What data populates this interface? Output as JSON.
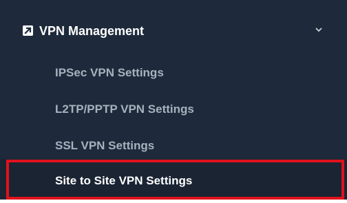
{
  "menu": {
    "header": {
      "label": "VPN Management",
      "icon": "external-link-icon",
      "chevron_icon": "chevron-down-icon",
      "expanded": true
    },
    "items": [
      {
        "label": "IPSec VPN Settings",
        "active": false
      },
      {
        "label": "L2TP/PPTP VPN Settings",
        "active": false
      },
      {
        "label": "SSL VPN Settings",
        "active": false
      },
      {
        "label": "Site to Site VPN Settings",
        "active": true,
        "highlighted": true
      }
    ]
  },
  "colors": {
    "background": "#1e2a3b",
    "active_text": "#ffffff",
    "inactive_text": "#a8b1bd",
    "highlight_border": "#e0121c"
  }
}
